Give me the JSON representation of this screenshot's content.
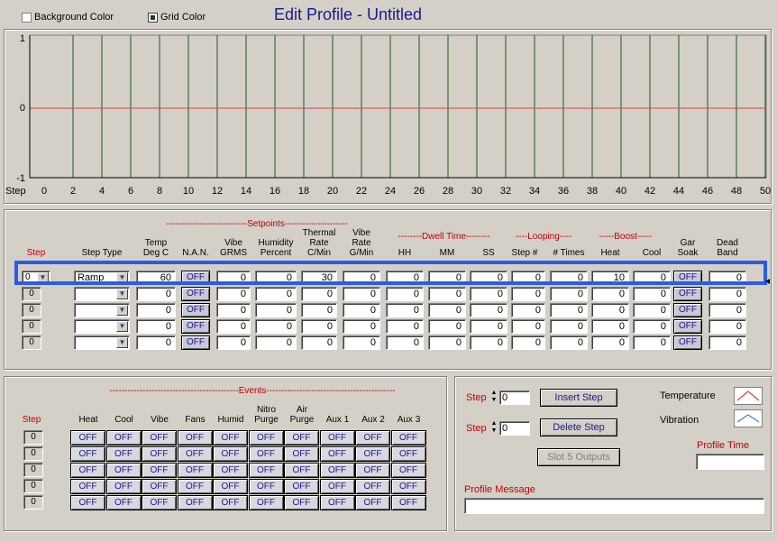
{
  "header": {
    "title": "Edit Profile - Untitled",
    "background_color_label": "Background Color",
    "grid_color_label": "Grid Color"
  },
  "graph": {
    "y_ticks": [
      "1",
      "0",
      "-1"
    ],
    "x_ticks": [
      "0",
      "2",
      "4",
      "6",
      "8",
      "10",
      "12",
      "14",
      "16",
      "18",
      "20",
      "22",
      "24",
      "26",
      "28",
      "30",
      "32",
      "34",
      "36",
      "38",
      "40",
      "42",
      "44",
      "46",
      "48",
      "50"
    ],
    "x_label": "Step"
  },
  "setpoints": {
    "group_setpoints": "---------------------------Setpoints---------------------",
    "group_dwell": "--------Dwell Time--------",
    "group_looping": "----Looping----",
    "group_boost": "-----Boost-----",
    "headers": {
      "step": "Step",
      "step_type": "Step Type",
      "temp": "Temp\nDeg C",
      "nan": "N.A.N.",
      "vibe": "Vibe\nGRMS",
      "humidity": "Humidity\nPercent",
      "thermal": "Thermal\nRate\nC/Min",
      "viberate": "Vibe\nRate\nG/Min",
      "hh": "HH",
      "mm": "MM",
      "ss": "SS",
      "stepnum": "Step #",
      "times": "# Times",
      "heat": "Heat",
      "cool": "Cool",
      "gar": "Gar\nSoak",
      "dead": "Dead\nBand"
    },
    "rows": [
      {
        "step": "0",
        "type": "Ramp",
        "temp": "60",
        "nan": "OFF",
        "vibe": "0",
        "hum": "0",
        "thermal": "30",
        "viberate": "0",
        "hh": "0",
        "mm": "0",
        "ss": "0",
        "stepnum": "0",
        "times": "0",
        "heat": "10",
        "cool": "0",
        "gar": "OFF",
        "dead": "0"
      },
      {
        "step": "0",
        "type": "",
        "temp": "0",
        "nan": "OFF",
        "vibe": "0",
        "hum": "0",
        "thermal": "0",
        "viberate": "0",
        "hh": "0",
        "mm": "0",
        "ss": "0",
        "stepnum": "0",
        "times": "0",
        "heat": "0",
        "cool": "0",
        "gar": "OFF",
        "dead": "0"
      },
      {
        "step": "0",
        "type": "",
        "temp": "0",
        "nan": "OFF",
        "vibe": "0",
        "hum": "0",
        "thermal": "0",
        "viberate": "0",
        "hh": "0",
        "mm": "0",
        "ss": "0",
        "stepnum": "0",
        "times": "0",
        "heat": "0",
        "cool": "0",
        "gar": "OFF",
        "dead": "0"
      },
      {
        "step": "0",
        "type": "",
        "temp": "0",
        "nan": "OFF",
        "vibe": "0",
        "hum": "0",
        "thermal": "0",
        "viberate": "0",
        "hh": "0",
        "mm": "0",
        "ss": "0",
        "stepnum": "0",
        "times": "0",
        "heat": "0",
        "cool": "0",
        "gar": "OFF",
        "dead": "0"
      },
      {
        "step": "0",
        "type": "",
        "temp": "0",
        "nan": "OFF",
        "vibe": "0",
        "hum": "0",
        "thermal": "0",
        "viberate": "0",
        "hh": "0",
        "mm": "0",
        "ss": "0",
        "stepnum": "0",
        "times": "0",
        "heat": "0",
        "cool": "0",
        "gar": "OFF",
        "dead": "0"
      }
    ]
  },
  "events": {
    "group": "-------------------------------------------Events-------------------------------------------",
    "step_label": "Step",
    "headers": [
      "Heat",
      "Cool",
      "Vibe",
      "Fans",
      "Humid",
      "Nitro\nPurge",
      "Air\nPurge",
      "Aux 1",
      "Aux 2",
      "Aux 3"
    ],
    "off_label": "OFF",
    "rows": [
      "0",
      "0",
      "0",
      "0",
      "0"
    ]
  },
  "controls": {
    "step_label_1": "Step",
    "step_value_1": "0",
    "step_label_2": "Step",
    "step_value_2": "0",
    "insert_step": "Insert Step",
    "delete_step": "Delete Step",
    "slot5": "Slot 5 Outputs",
    "legend_temp": "Temperature",
    "legend_vib": "Vibration",
    "profile_time_label": "Profile Time",
    "profile_time_value": "",
    "profile_message_label": "Profile Message",
    "profile_message_value": ""
  },
  "colors": {
    "trace_temperature": "#e04040",
    "trace_vibration": "#4080e0",
    "grid_lines": "#1a5a1a",
    "selection_highlight": "#2a5ce6"
  }
}
